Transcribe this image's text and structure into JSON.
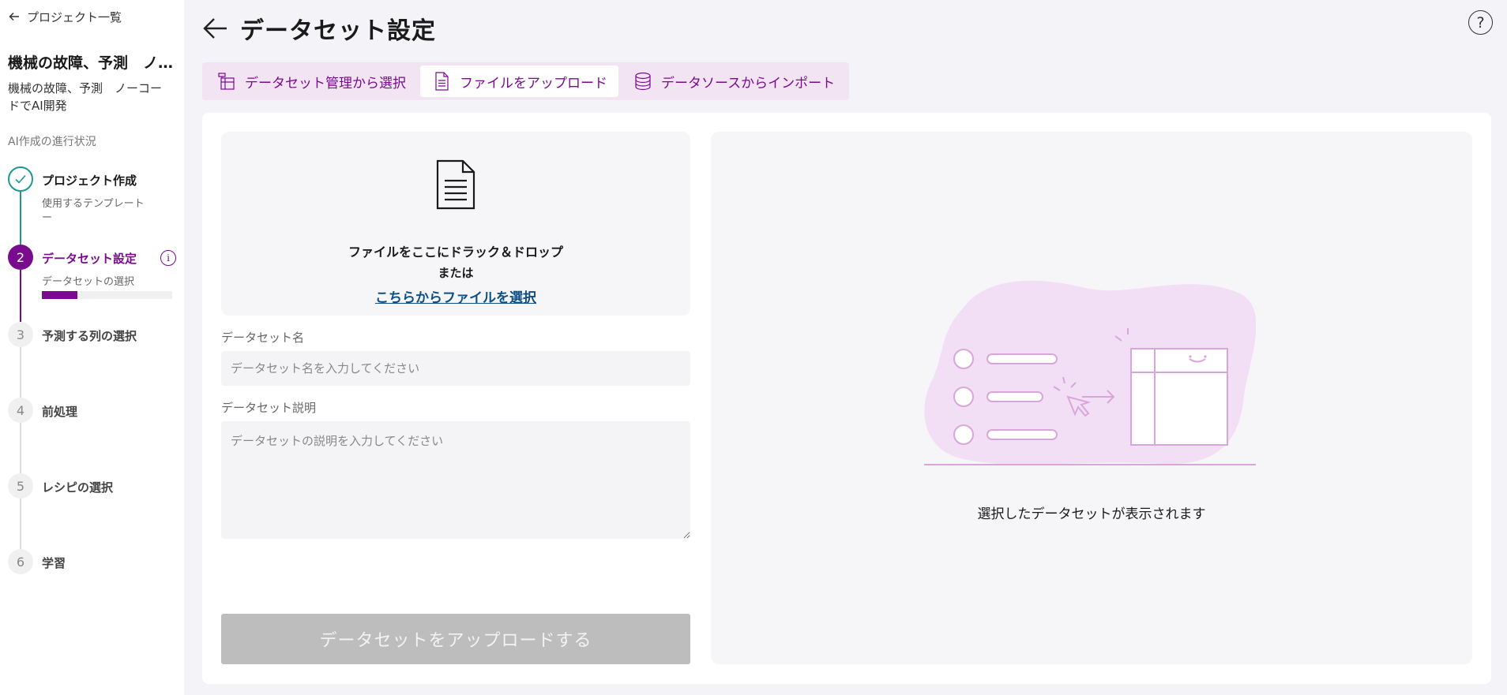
{
  "sidebar": {
    "back_label": "プロジェクト一覧",
    "project_title": "機械の故障、予測 ノーコードでAI開発",
    "project_title_display": "機械の故障、予測　ノ…",
    "project_desc": "機械の故障、予測　ノーコードでAI開発",
    "progress_label": "AI作成の進行状況",
    "steps": [
      {
        "number": "",
        "title": "プロジェクト作成",
        "sub1": "使用するテンプレート",
        "sub2": "ー",
        "state": "done"
      },
      {
        "number": "2",
        "title": "データセット設定",
        "sub1": "データセットの選択",
        "state": "active",
        "progress": 0.27
      },
      {
        "number": "3",
        "title": "予測する列の選択",
        "state": "todo"
      },
      {
        "number": "4",
        "title": "前処理",
        "state": "todo"
      },
      {
        "number": "5",
        "title": "レシピの選択",
        "state": "todo"
      },
      {
        "number": "6",
        "title": "学習",
        "state": "todo"
      }
    ]
  },
  "header": {
    "title": "データセット設定",
    "help_label": "?"
  },
  "tabs": [
    {
      "label": "データセット管理から選択",
      "icon": "dataset-manage-icon",
      "active": false
    },
    {
      "label": "ファイルをアップロード",
      "icon": "file-icon",
      "active": true
    },
    {
      "label": "データソースからインポート",
      "icon": "database-icon",
      "active": false
    }
  ],
  "upload": {
    "drop_text": "ファイルをここにドラック＆ドロップ",
    "or_text": "または",
    "select_link": "こちらからファイルを選択"
  },
  "form": {
    "name_label": "データセット名",
    "name_placeholder": "データセット名を入力してください",
    "desc_label": "データセット説明",
    "desc_placeholder": "データセットの説明を入力してください",
    "submit_label": "データセットをアップロードする"
  },
  "preview": {
    "message": "選択したデータセットが表示されます"
  },
  "colors": {
    "accent": "#7a0b8f",
    "done": "#1b9a8c",
    "tab_bg": "#f3e4f4",
    "link": "#0e4f86",
    "illustration": "#d9a6db"
  }
}
